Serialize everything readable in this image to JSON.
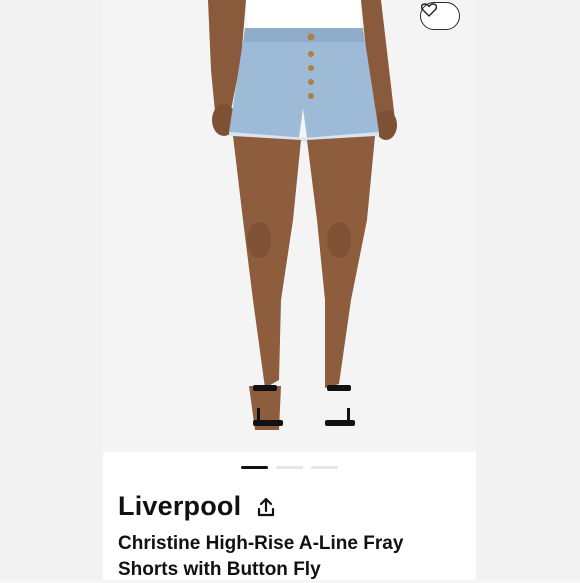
{
  "product": {
    "brand": "Liverpool",
    "title": "Christine High-Rise A-Line Fray Shorts with Button Fly"
  },
  "gallery": {
    "image_count": 3,
    "active_index": 0
  },
  "icons": {
    "favorite": "heart-icon",
    "share": "share-icon"
  },
  "colors": {
    "denim": "#9dbad6",
    "text": "#111111",
    "active_dot": "#111111",
    "inactive_dot": "#e6e6e6"
  }
}
